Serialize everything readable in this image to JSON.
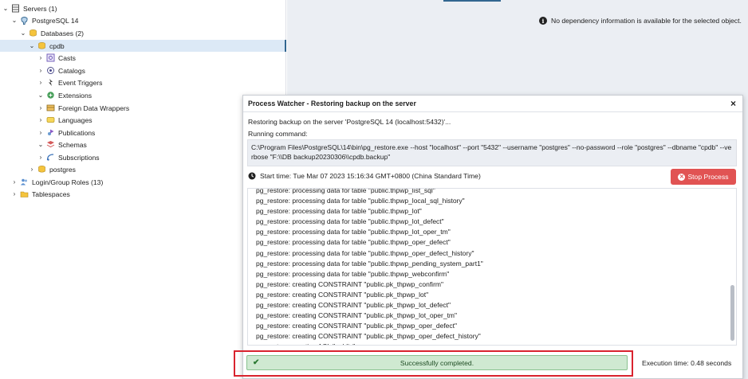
{
  "tree": {
    "items": [
      {
        "label": "Servers (1)",
        "chev": "⌄",
        "icon": "server-group-icon",
        "depth": 0
      },
      {
        "label": "PostgreSQL 14",
        "chev": "⌄",
        "icon": "postgres-elephant-icon",
        "depth": 1
      },
      {
        "label": "Databases (2)",
        "chev": "⌄",
        "icon": "databases-icon",
        "depth": 2
      },
      {
        "label": "cpdb",
        "chev": "⌄",
        "icon": "database-icon",
        "depth": 3
      },
      {
        "label": "Casts",
        "chev": "›",
        "icon": "casts-icon",
        "depth": 4
      },
      {
        "label": "Catalogs",
        "chev": "›",
        "icon": "catalogs-icon",
        "depth": 4
      },
      {
        "label": "Event Triggers",
        "chev": "›",
        "icon": "event-triggers-icon",
        "depth": 4
      },
      {
        "label": "Extensions",
        "chev": "⌄",
        "icon": "extensions-icon",
        "depth": 4
      },
      {
        "label": "Foreign Data Wrappers",
        "chev": "›",
        "icon": "foreign-data-wrappers-icon",
        "depth": 4
      },
      {
        "label": "Languages",
        "chev": "›",
        "icon": "languages-icon",
        "depth": 4
      },
      {
        "label": "Publications",
        "chev": "›",
        "icon": "publications-icon",
        "depth": 4
      },
      {
        "label": "Schemas",
        "chev": "⌄",
        "icon": "schemas-icon",
        "depth": 4
      },
      {
        "label": "Subscriptions",
        "chev": "›",
        "icon": "subscriptions-icon",
        "depth": 4
      },
      {
        "label": "postgres",
        "chev": "›",
        "icon": "database-icon",
        "depth": 3
      },
      {
        "label": "Login/Group Roles (13)",
        "chev": "›",
        "icon": "login-roles-icon",
        "depth": 1
      },
      {
        "label": "Tablespaces",
        "chev": "›",
        "icon": "tablespaces-icon",
        "depth": 1
      }
    ],
    "selected_index": 3
  },
  "dependency_info": "No dependency information is available for the selected object.",
  "dialog": {
    "title": "Process Watcher - Restoring backup on the server",
    "close": "×",
    "restoring_text": "Restoring backup on the server 'PostgreSQL 14 (localhost:5432)'...",
    "running_label": "Running command:",
    "command": "C:\\Program Files\\PostgreSQL\\14\\bin\\pg_restore.exe --host \"localhost\" --port \"5432\" --username \"postgres\" --no-password --role \"postgres\" --dbname \"cpdb\" --verbose \"F:\\\\DB backup20230306\\\\cpdb.backup\"",
    "start_time": "Start time: Tue Mar 07 2023 15:16:34 GMT+0800 (China Standard Time)",
    "stop_label": "Stop Process",
    "log_lines": [
      "pg_restore: processing data for table \"public.thpwp_list_sql\"",
      "pg_restore: processing data for table \"public.thpwp_local_sql_history\"",
      "pg_restore: processing data for table \"public.thpwp_lot\"",
      "pg_restore: processing data for table \"public.thpwp_lot_defect\"",
      "pg_restore: processing data for table \"public.thpwp_lot_oper_tm\"",
      "pg_restore: processing data for table \"public.thpwp_oper_defect\"",
      "pg_restore: processing data for table \"public.thpwp_oper_defect_history\"",
      "pg_restore: processing data for table \"public.thpwp_pending_system_part1\"",
      "pg_restore: processing data for table \"public.thpwp_webconfirm\"",
      "pg_restore: creating CONSTRAINT \"public.pk_thpwp_confirm\"",
      "pg_restore: creating CONSTRAINT \"public.pk_thpwp_lot\"",
      "pg_restore: creating CONSTRAINT \"public.pk_thpwp_lot_defect\"",
      "pg_restore: creating CONSTRAINT \"public.pk_thpwp_lot_oper_tm\"",
      "pg_restore: creating CONSTRAINT \"public.pk_thpwp_oper_defect\"",
      "pg_restore: creating CONSTRAINT \"public.pk_thpwp_oper_defect_history\"",
      "pg_restore: creating ACL \"public\""
    ],
    "success_text": "Successfully completed.",
    "execution_time": "Execution time: 0.48 seconds"
  },
  "colors": {
    "accent": "#326690",
    "stop_button": "#e15353",
    "success_bg": "#cfe9d1",
    "highlight_outline": "#d9232e"
  }
}
